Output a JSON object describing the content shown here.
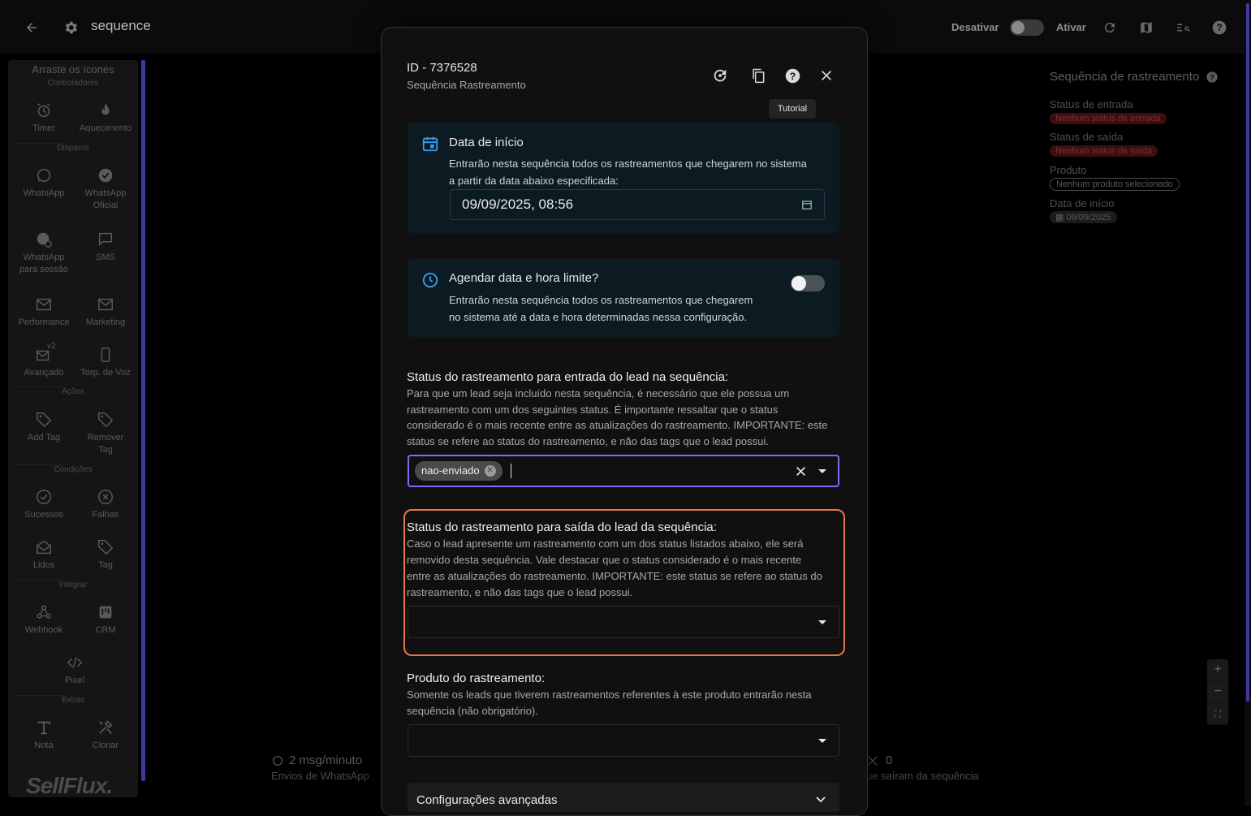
{
  "app": {
    "title": "sequence",
    "deactivate_label": "Desativar",
    "activate_label": "Ativar",
    "logo_text": "SellFlux."
  },
  "sidebar": {
    "header": "Arraste os ícones",
    "sections": {
      "controladores": "Controladores",
      "disparos": "Disparos",
      "acoes": "Ações",
      "condicoes": "Condições",
      "integrar": "Integrar",
      "extras": "Extras"
    },
    "items": {
      "timer": "Timer",
      "aquecimento": "Aquecimento",
      "whatsapp": "WhatsApp",
      "whatsapp_oficial_1": "WhatsApp",
      "whatsapp_oficial_2": "Oficial",
      "whatsapp_sessao_1": "WhatsApp",
      "whatsapp_sessao_2": "para sessão",
      "sms": "SMS",
      "performance": "Performance",
      "marketing": "Marketing",
      "avancado": "Avançado",
      "avancado_badge": "v2",
      "torp_voz": "Torp. de Voz",
      "add_tag": "Add Tag",
      "remover_tag_1": "Remover",
      "remover_tag_2": "Tag",
      "sucessos": "Sucessos",
      "falhas": "Falhas",
      "lidos": "Lidos",
      "tag": "Tag",
      "webhook": "Webhook",
      "crm": "CRM",
      "pixel": "Pixel",
      "nota": "Nota",
      "clonar": "Clonar"
    }
  },
  "right_panel": {
    "title": "Sequência de rastreamento",
    "entry_label": "Status de entrada",
    "entry_badge": "Nenhum status de entrada",
    "exit_label": "Status de saída",
    "exit_badge": "Nenhum status de saída",
    "product_label": "Produto",
    "product_badge": "Nenhum produto selecionado",
    "start_label": "Data de início",
    "start_badge": "09/09/2025"
  },
  "stats": {
    "rate_value": "2 msg/minuto",
    "rate_label": "Envios de WhatsApp",
    "left_value": "0",
    "left_label": "ue saíram da sequência"
  },
  "zoom": {
    "plus": "+",
    "minus": "−"
  },
  "modal": {
    "id": "ID - 7376528",
    "subtitle": "Sequência Rastreamento",
    "tooltip": "Tutorial",
    "start_card": {
      "title": "Data de início",
      "desc1": "Entrarão nesta sequência todos os rastreamentos que chegarem no sistema",
      "desc2": "a partir da data abaixo especificada:",
      "date_value": "09/09/2025, 08:56"
    },
    "limit_card": {
      "title": "Agendar data e hora limite?",
      "desc1": "Entrarão nesta sequência todos os rastreamentos que chegarem",
      "desc2": "no sistema até a data e hora determinadas nessa configuração."
    },
    "entry_section": {
      "title": "Status do rastreamento para entrada do lead na sequência:",
      "desc1": "Para que um lead seja incluído nesta sequência, é necessário que ele possua um",
      "desc2": "rastreamento com um dos seguintes status. É importante ressaltar que o status",
      "desc3": "considerado é o mais recente entre as atualizações do rastreamento. IMPORTANTE: este",
      "desc4": "status se refere ao status do rastreamento, e não das tags que o lead possui.",
      "chip": "nao-enviado"
    },
    "exit_section": {
      "title": "Status do rastreamento para saída do lead da sequência:",
      "desc1": "Caso o lead apresente um rastreamento com um dos status listados abaixo, ele será",
      "desc2": "removido desta sequência. Vale destacar que o status considerado é o mais recente",
      "desc3": "entre as atualizações do rastreamento. IMPORTANTE: este status se refere ao status do",
      "desc4": "rastreamento, e não das tags que o lead possui."
    },
    "product_section": {
      "title": "Produto do rastreamento:",
      "desc1": "Somente os leads que tiverem rastreamentos referentes à este produto entrarão nesta",
      "desc2": "sequência (não obrigatório)."
    },
    "advanced": "Configurações avançadas"
  },
  "colors": {
    "accent_purple": "#7b6cf6",
    "highlight_orange": "#e8744d",
    "card_bg": "#0c1a22",
    "icon_blue": "#3aa0f0"
  }
}
